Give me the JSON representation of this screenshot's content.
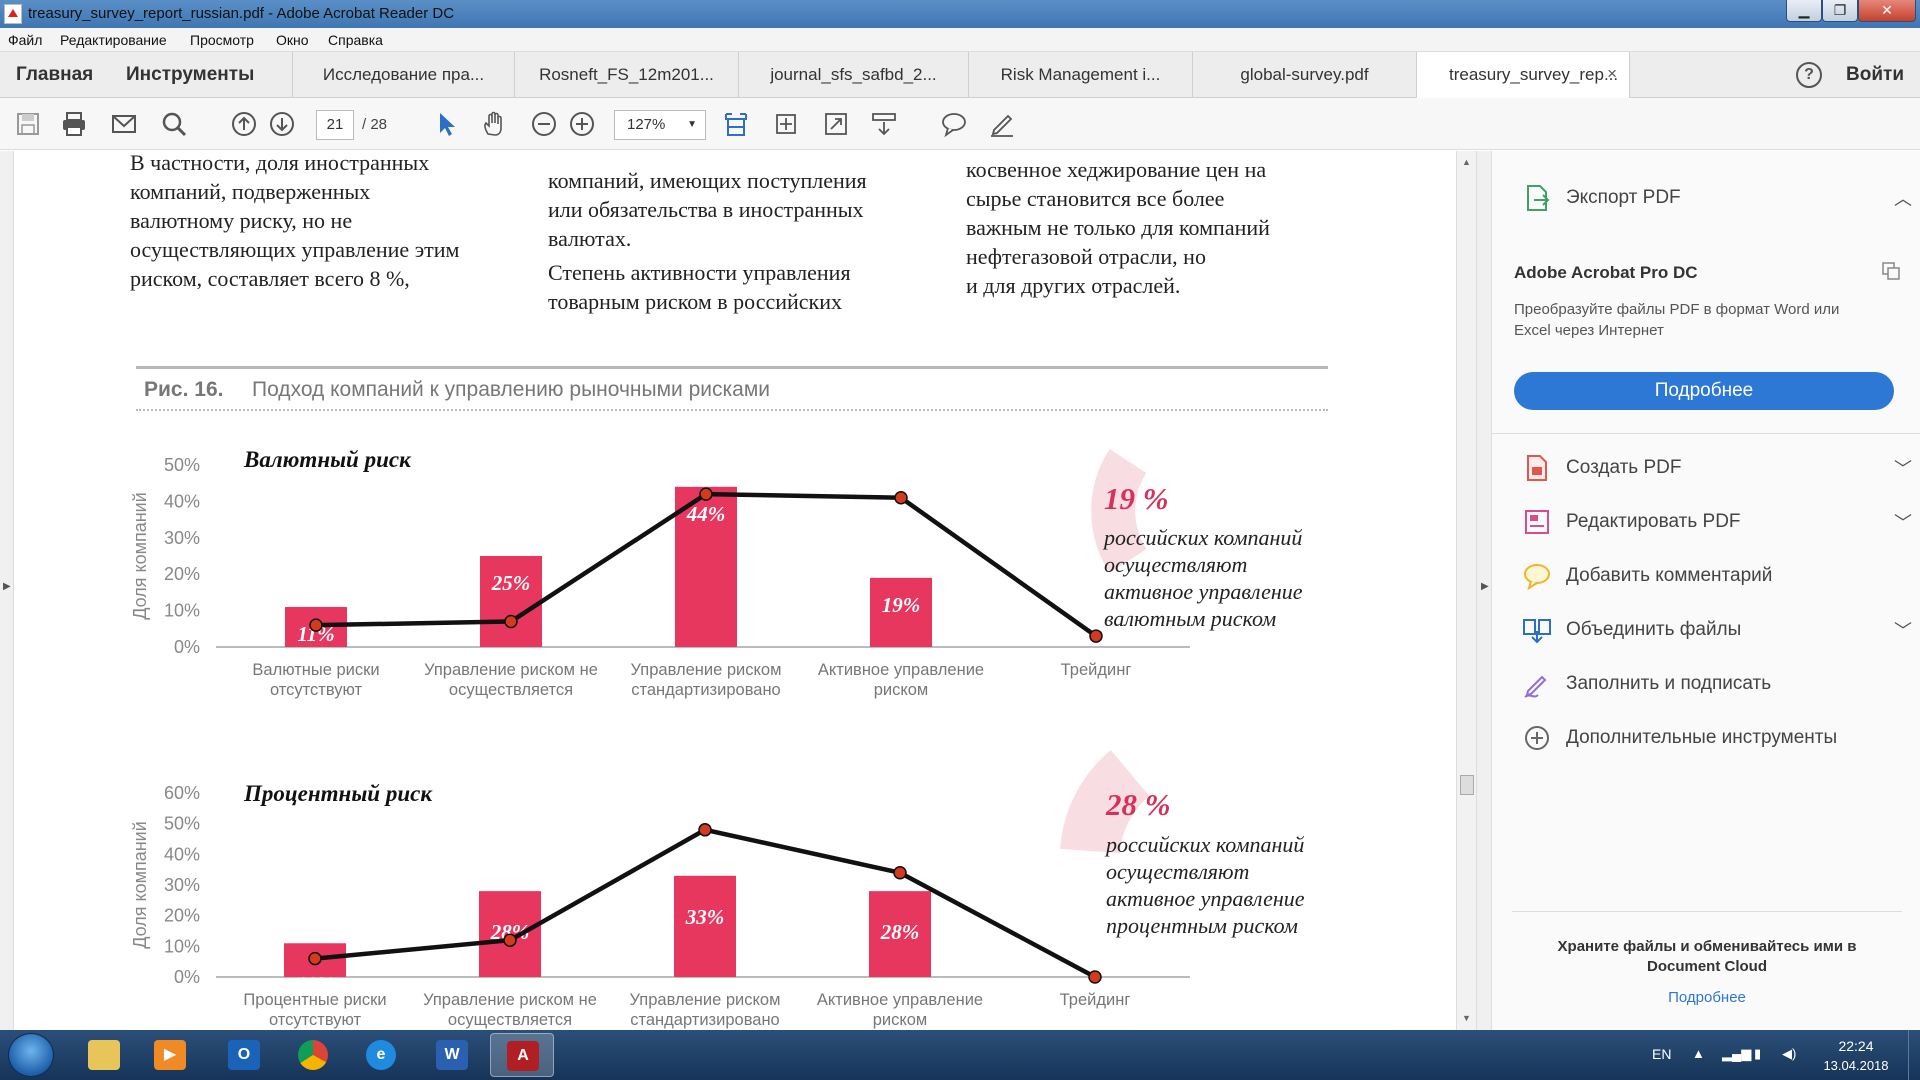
{
  "window": {
    "title": "treasury_survey_report_russian.pdf - Adobe Acrobat Reader DC",
    "min_label": "▁",
    "max_label": "❐",
    "close_label": "✕"
  },
  "menu": [
    "Файл",
    "Редактирование",
    "Просмотр",
    "Окно",
    "Справка"
  ],
  "nav_tabs": {
    "home": "Главная",
    "tools": "Инструменты"
  },
  "doc_tabs": [
    {
      "label": "Исследование пра..."
    },
    {
      "label": "Rosneft_FS_12m201..."
    },
    {
      "label": "journal_sfs_safbd_2..."
    },
    {
      "label": "Risk Management i..."
    },
    {
      "label": "global-survey.pdf"
    },
    {
      "label": "treasury_survey_rep...",
      "active": true,
      "close": "×"
    }
  ],
  "header_right": {
    "help": "?",
    "sign_in": "Войти"
  },
  "toolbar": {
    "page_current": "21",
    "page_total": "/  28",
    "zoom": "127%",
    "icons": [
      "save-icon",
      "print-icon",
      "email-icon",
      "search-icon",
      "prev-page-icon",
      "next-page-icon",
      "select-cursor-icon",
      "hand-tool-icon",
      "zoom-out-icon",
      "zoom-in-icon",
      "fit-page-icon",
      "rotate-icon",
      "fullscreen-icon",
      "scroll-mode-icon",
      "comment-icon",
      "sign-icon"
    ]
  },
  "document": {
    "col1": "В частности, доля иностранных\nкомпаний, подверженных\nвалютному риску, но не\nосуществляющих управление этим\nриском, составляет всего 8 %,",
    "col2": "компаний, имеющих поступления\nили обязательства в иностранных\nвалютах.",
    "col2b": "Степень активности управления\nтоварным риском в российских",
    "col3": "косвенное хеджирование цен на\nсырье становится все более\nважным не только для компаний\nнефтегазовой отрасли, но\nи для других отраслей.",
    "figure_number": "Рис. 16.",
    "figure_title": "Подход компаний к управлению рыночными рисками",
    "callout1_value": "19 %",
    "callout1_text": "российских компаний\nосуществляют\nактивное управление\nвалютным риском",
    "callout2_value": "28 %",
    "callout2_text": "российских компаний\nосуществляют\nактивное управление\nпроцентным риском"
  },
  "chart_data": [
    {
      "type": "bar",
      "title": "Валютный риск",
      "ylabel": "Доля компаний",
      "ylim": [
        0,
        50
      ],
      "yticks": [
        "0%",
        "10%",
        "20%",
        "30%",
        "40%",
        "50%"
      ],
      "categories": [
        "Валютные риски\nотсутствуют",
        "Управление риском не\nосуществляется",
        "Управление риском\nстандартизировано",
        "Активное управление\nриском",
        "Трейдинг"
      ],
      "series": [
        {
          "kind": "bar",
          "values": [
            11,
            25,
            44,
            19,
            0
          ],
          "labels": [
            "11%",
            "25%",
            "44%",
            "19%",
            ""
          ]
        },
        {
          "kind": "line",
          "values": [
            6,
            7,
            42,
            41,
            3
          ]
        }
      ],
      "bar_color": "#e8375f",
      "line_color": "#111111",
      "marker_color": "#d43a1e"
    },
    {
      "type": "bar",
      "title": "Процентный риск",
      "ylabel": "Доля компаний",
      "ylim": [
        0,
        60
      ],
      "yticks": [
        "0%",
        "10%",
        "20%",
        "30%",
        "40%",
        "50%",
        "60%"
      ],
      "categories": [
        "Процентные риски\nотсутствуют",
        "Управление риском не\nосуществляется",
        "Управление риском\nстандартизировано",
        "Активное управление\nриском",
        "Трейдинг"
      ],
      "series": [
        {
          "kind": "bar",
          "values": [
            11,
            28,
            33,
            28,
            0
          ],
          "labels": [
            "11%",
            "28%",
            "33%",
            "28%",
            ""
          ]
        },
        {
          "kind": "line",
          "values": [
            6,
            12,
            48,
            34,
            0
          ]
        }
      ],
      "bar_color": "#e8375f",
      "line_color": "#111111",
      "marker_color": "#d43a1e"
    }
  ],
  "right_panel": {
    "export_pdf": "Экспорт PDF",
    "product": "Adobe Acrobat Pro DC",
    "description": "Преобразуйте файлы PDF в формат Word или Excel через Интернет",
    "more_button": "Подробнее",
    "tools": [
      "Создать PDF",
      "Редактировать PDF",
      "Добавить комментарий",
      "Объединить файлы",
      "Заполнить и подписать",
      "Дополнительные инструменты"
    ],
    "cloud_text": "Храните файлы и обменивайтесь ими в Document Cloud",
    "cloud_link": "Подробнее"
  },
  "taskbar": {
    "apps": [
      "explorer",
      "media-player",
      "outlook",
      "chrome",
      "internet-explorer",
      "word",
      "acrobat"
    ],
    "lang": "EN",
    "time": "22:24",
    "date": "13.04.2018"
  }
}
